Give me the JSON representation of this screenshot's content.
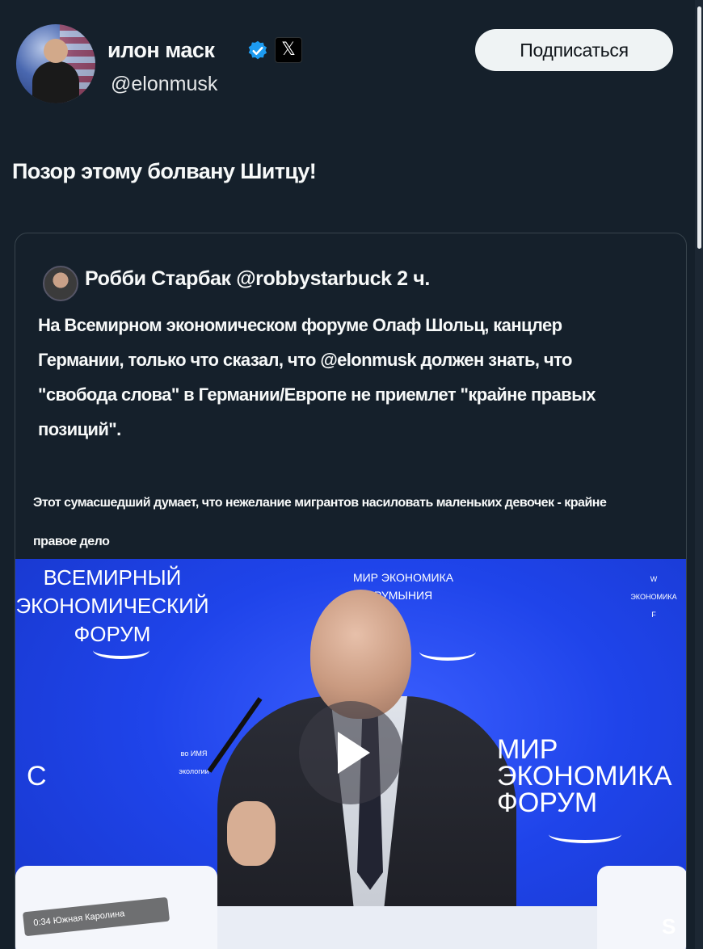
{
  "tweet": {
    "author_name": "илон маск",
    "author_handle": "@elonmusk",
    "follow_label": "Подписаться",
    "x_logo": "𝕏",
    "text": "Позор этому болвану Шитцу!"
  },
  "quote": {
    "header": "Робби Старбак @robbystarbuck 2 ч.",
    "body": "На Всемирном экономическом форуме Олаф Шольц, канцлер Германии, только что сказал, что @elonmusk должен знать, что \"свобода слова\" в Германии/Европе не приемлет \"крайне правых позиций\".",
    "caption": "Этот сумасшедший думает, что нежелание мигрантов насиловать маленьких девочек - крайне правое дело"
  },
  "video": {
    "logo_top_left": [
      "ВСЕМИРНЫЙ",
      "ЭКОНОМИЧЕСКИЙ",
      "ФОРУМ"
    ],
    "logo_top_center": [
      "МИР ЭКОНОМИКА",
      "РУМЫНИЯ"
    ],
    "logo_top_right": [
      "W",
      "ЭКОНОМИКА",
      "F"
    ],
    "logo_mid_left": [
      "во ИМЯ",
      "экологии"
    ],
    "logo_right": [
      "МИР",
      "ЭКОНОМИКА",
      "ФОРУМ"
    ],
    "letter_left": "C",
    "letter_right": "S",
    "timestamp": "0:34 Южная Каролина"
  },
  "colors": {
    "background": "#15202b",
    "verified": "#1d9bf0",
    "video_blue": "#1f44ea"
  },
  "icons": [
    "verified-badge-icon",
    "x-logo-icon",
    "play-icon"
  ]
}
